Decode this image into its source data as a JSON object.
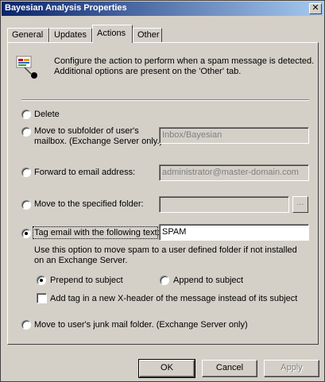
{
  "window": {
    "title": "Bayesian Analysis Properties"
  },
  "tabs": [
    {
      "label": "General",
      "active": false
    },
    {
      "label": "Updates",
      "active": false
    },
    {
      "label": "Actions",
      "active": true
    },
    {
      "label": "Other",
      "active": false
    }
  ],
  "info": {
    "icon": "filter-icon",
    "line1": "Configure the action to perform when a spam message is detected.",
    "line2": "Additional options are present on the 'Other' tab."
  },
  "options": {
    "delete": {
      "label": "Delete",
      "selected": false
    },
    "move_subfolder": {
      "line1": "Move to subfolder of user's",
      "line2": "mailbox. (Exchange Server only.)",
      "selected": false,
      "value": "Inbox/Bayesian"
    },
    "forward": {
      "label": "Forward to email address:",
      "selected": false,
      "value": "administrator@master-domain.com"
    },
    "move_folder": {
      "label": "Move to the specified folder:",
      "selected": false,
      "value": "",
      "browse_label": "..."
    },
    "tag_email": {
      "label": "Tag email with the following text:",
      "selected": true,
      "value": "SPAM",
      "hint": "Use this option to move spam to a user defined folder if not installed on an Exchange Server.",
      "prepend_label": "Prepend to subject",
      "prepend_selected": true,
      "append_label": "Append to subject",
      "append_selected": false,
      "header_checkbox_label": "Add tag in a new X-header of the message instead of its subject",
      "header_checkbox_checked": false
    },
    "junk": {
      "label": "Move to user's junk mail folder. (Exchange Server only)",
      "selected": false
    }
  },
  "buttons": {
    "ok": "OK",
    "cancel": "Cancel",
    "apply": "Apply"
  }
}
